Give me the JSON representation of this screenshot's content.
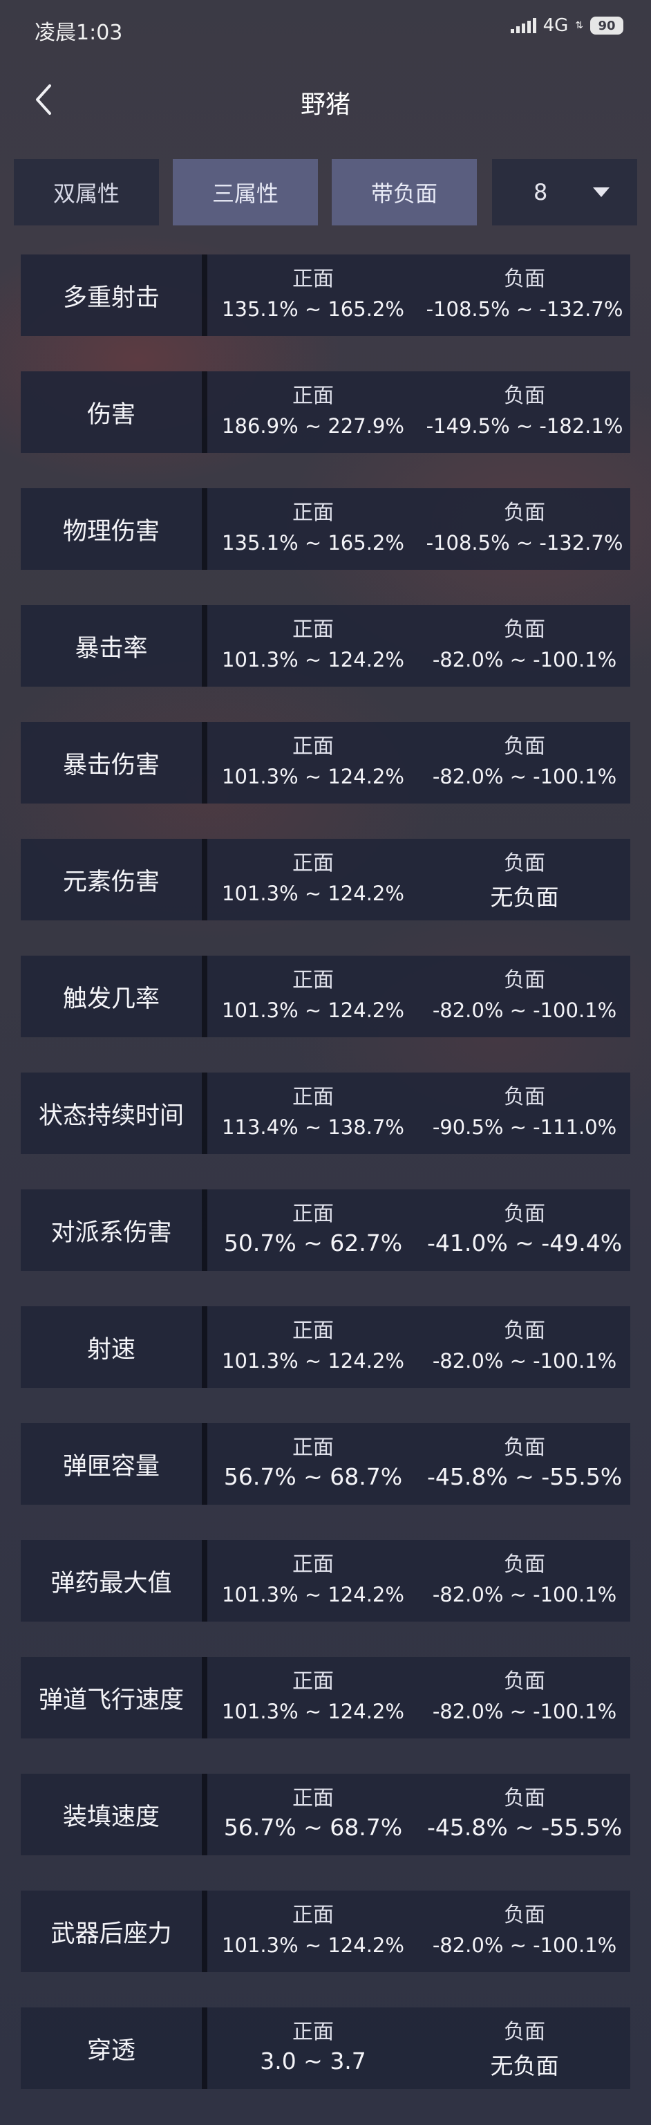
{
  "status": {
    "time": "凌晨1:03",
    "network": "4G",
    "battery": "90"
  },
  "header": {
    "title": "野猪"
  },
  "tabs": [
    {
      "label": "双属性",
      "active": false
    },
    {
      "label": "三属性",
      "active": true
    },
    {
      "label": "带负面",
      "active": true
    }
  ],
  "select": {
    "value": "8"
  },
  "columns": {
    "positive": "正面",
    "negative": "负面"
  },
  "rows": [
    {
      "label": "多重射击",
      "positive": "135.1% ~ 165.2%",
      "negative": "-108.5% ~ -132.7%"
    },
    {
      "label": "伤害",
      "positive": "186.9% ~ 227.9%",
      "negative": "-149.5% ~ -182.1%"
    },
    {
      "label": "物理伤害",
      "positive": "135.1% ~ 165.2%",
      "negative": "-108.5% ~ -132.7%"
    },
    {
      "label": "暴击率",
      "positive": "101.3% ~ 124.2%",
      "negative": "-82.0% ~ -100.1%"
    },
    {
      "label": "暴击伤害",
      "positive": "101.3% ~ 124.2%",
      "negative": "-82.0% ~ -100.1%"
    },
    {
      "label": "元素伤害",
      "positive": "101.3% ~ 124.2%",
      "negative": "无负面"
    },
    {
      "label": "触发几率",
      "positive": "101.3% ~ 124.2%",
      "negative": "-82.0% ~ -100.1%"
    },
    {
      "label": "状态持续时间",
      "positive": "113.4% ~ 138.7%",
      "negative": "-90.5% ~ -111.0%"
    },
    {
      "label": "对派系伤害",
      "positive": "50.7% ~ 62.7%",
      "negative": "-41.0% ~ -49.4%"
    },
    {
      "label": "射速",
      "positive": "101.3% ~ 124.2%",
      "negative": "-82.0% ~ -100.1%"
    },
    {
      "label": "弹匣容量",
      "positive": "56.7% ~ 68.7%",
      "negative": "-45.8% ~ -55.5%"
    },
    {
      "label": "弹药最大值",
      "positive": "101.3% ~ 124.2%",
      "negative": "-82.0% ~ -100.1%"
    },
    {
      "label": "弹道飞行速度",
      "positive": "101.3% ~ 124.2%",
      "negative": "-82.0% ~ -100.1%"
    },
    {
      "label": "装填速度",
      "positive": "56.7% ~ 68.7%",
      "negative": "-45.8% ~ -55.5%"
    },
    {
      "label": "武器后座力",
      "positive": "101.3% ~ 124.2%",
      "negative": "-82.0% ~ -100.1%"
    },
    {
      "label": "穿透",
      "positive": "3.0 ~ 3.7",
      "negative": "无负面"
    }
  ]
}
